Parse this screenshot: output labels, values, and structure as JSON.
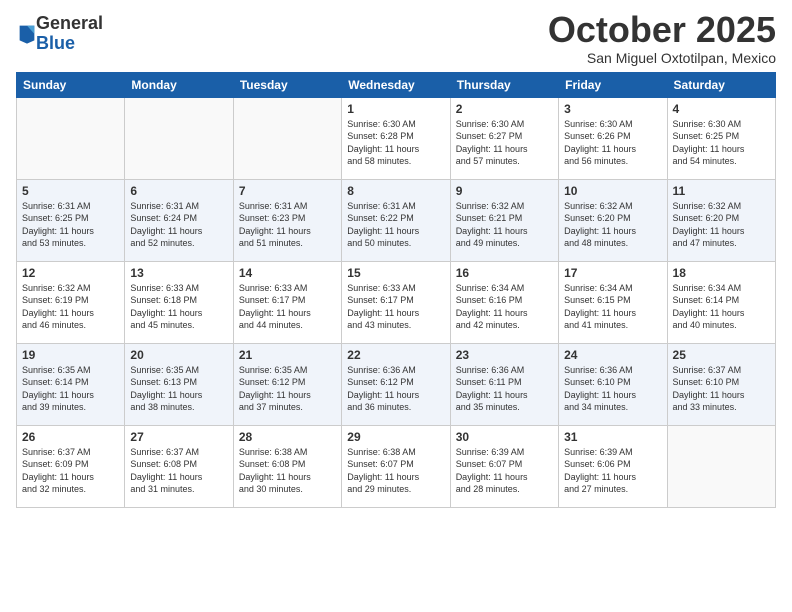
{
  "logo": {
    "general": "General",
    "blue": "Blue"
  },
  "title": {
    "month": "October 2025",
    "location": "San Miguel Oxtotilpan, Mexico"
  },
  "weekdays": [
    "Sunday",
    "Monday",
    "Tuesday",
    "Wednesday",
    "Thursday",
    "Friday",
    "Saturday"
  ],
  "weeks": [
    [
      {
        "day": "",
        "info": ""
      },
      {
        "day": "",
        "info": ""
      },
      {
        "day": "",
        "info": ""
      },
      {
        "day": "1",
        "info": "Sunrise: 6:30 AM\nSunset: 6:28 PM\nDaylight: 11 hours\nand 58 minutes."
      },
      {
        "day": "2",
        "info": "Sunrise: 6:30 AM\nSunset: 6:27 PM\nDaylight: 11 hours\nand 57 minutes."
      },
      {
        "day": "3",
        "info": "Sunrise: 6:30 AM\nSunset: 6:26 PM\nDaylight: 11 hours\nand 56 minutes."
      },
      {
        "day": "4",
        "info": "Sunrise: 6:30 AM\nSunset: 6:25 PM\nDaylight: 11 hours\nand 54 minutes."
      }
    ],
    [
      {
        "day": "5",
        "info": "Sunrise: 6:31 AM\nSunset: 6:25 PM\nDaylight: 11 hours\nand 53 minutes."
      },
      {
        "day": "6",
        "info": "Sunrise: 6:31 AM\nSunset: 6:24 PM\nDaylight: 11 hours\nand 52 minutes."
      },
      {
        "day": "7",
        "info": "Sunrise: 6:31 AM\nSunset: 6:23 PM\nDaylight: 11 hours\nand 51 minutes."
      },
      {
        "day": "8",
        "info": "Sunrise: 6:31 AM\nSunset: 6:22 PM\nDaylight: 11 hours\nand 50 minutes."
      },
      {
        "day": "9",
        "info": "Sunrise: 6:32 AM\nSunset: 6:21 PM\nDaylight: 11 hours\nand 49 minutes."
      },
      {
        "day": "10",
        "info": "Sunrise: 6:32 AM\nSunset: 6:20 PM\nDaylight: 11 hours\nand 48 minutes."
      },
      {
        "day": "11",
        "info": "Sunrise: 6:32 AM\nSunset: 6:20 PM\nDaylight: 11 hours\nand 47 minutes."
      }
    ],
    [
      {
        "day": "12",
        "info": "Sunrise: 6:32 AM\nSunset: 6:19 PM\nDaylight: 11 hours\nand 46 minutes."
      },
      {
        "day": "13",
        "info": "Sunrise: 6:33 AM\nSunset: 6:18 PM\nDaylight: 11 hours\nand 45 minutes."
      },
      {
        "day": "14",
        "info": "Sunrise: 6:33 AM\nSunset: 6:17 PM\nDaylight: 11 hours\nand 44 minutes."
      },
      {
        "day": "15",
        "info": "Sunrise: 6:33 AM\nSunset: 6:17 PM\nDaylight: 11 hours\nand 43 minutes."
      },
      {
        "day": "16",
        "info": "Sunrise: 6:34 AM\nSunset: 6:16 PM\nDaylight: 11 hours\nand 42 minutes."
      },
      {
        "day": "17",
        "info": "Sunrise: 6:34 AM\nSunset: 6:15 PM\nDaylight: 11 hours\nand 41 minutes."
      },
      {
        "day": "18",
        "info": "Sunrise: 6:34 AM\nSunset: 6:14 PM\nDaylight: 11 hours\nand 40 minutes."
      }
    ],
    [
      {
        "day": "19",
        "info": "Sunrise: 6:35 AM\nSunset: 6:14 PM\nDaylight: 11 hours\nand 39 minutes."
      },
      {
        "day": "20",
        "info": "Sunrise: 6:35 AM\nSunset: 6:13 PM\nDaylight: 11 hours\nand 38 minutes."
      },
      {
        "day": "21",
        "info": "Sunrise: 6:35 AM\nSunset: 6:12 PM\nDaylight: 11 hours\nand 37 minutes."
      },
      {
        "day": "22",
        "info": "Sunrise: 6:36 AM\nSunset: 6:12 PM\nDaylight: 11 hours\nand 36 minutes."
      },
      {
        "day": "23",
        "info": "Sunrise: 6:36 AM\nSunset: 6:11 PM\nDaylight: 11 hours\nand 35 minutes."
      },
      {
        "day": "24",
        "info": "Sunrise: 6:36 AM\nSunset: 6:10 PM\nDaylight: 11 hours\nand 34 minutes."
      },
      {
        "day": "25",
        "info": "Sunrise: 6:37 AM\nSunset: 6:10 PM\nDaylight: 11 hours\nand 33 minutes."
      }
    ],
    [
      {
        "day": "26",
        "info": "Sunrise: 6:37 AM\nSunset: 6:09 PM\nDaylight: 11 hours\nand 32 minutes."
      },
      {
        "day": "27",
        "info": "Sunrise: 6:37 AM\nSunset: 6:08 PM\nDaylight: 11 hours\nand 31 minutes."
      },
      {
        "day": "28",
        "info": "Sunrise: 6:38 AM\nSunset: 6:08 PM\nDaylight: 11 hours\nand 30 minutes."
      },
      {
        "day": "29",
        "info": "Sunrise: 6:38 AM\nSunset: 6:07 PM\nDaylight: 11 hours\nand 29 minutes."
      },
      {
        "day": "30",
        "info": "Sunrise: 6:39 AM\nSunset: 6:07 PM\nDaylight: 11 hours\nand 28 minutes."
      },
      {
        "day": "31",
        "info": "Sunrise: 6:39 AM\nSunset: 6:06 PM\nDaylight: 11 hours\nand 27 minutes."
      },
      {
        "day": "",
        "info": ""
      }
    ]
  ]
}
